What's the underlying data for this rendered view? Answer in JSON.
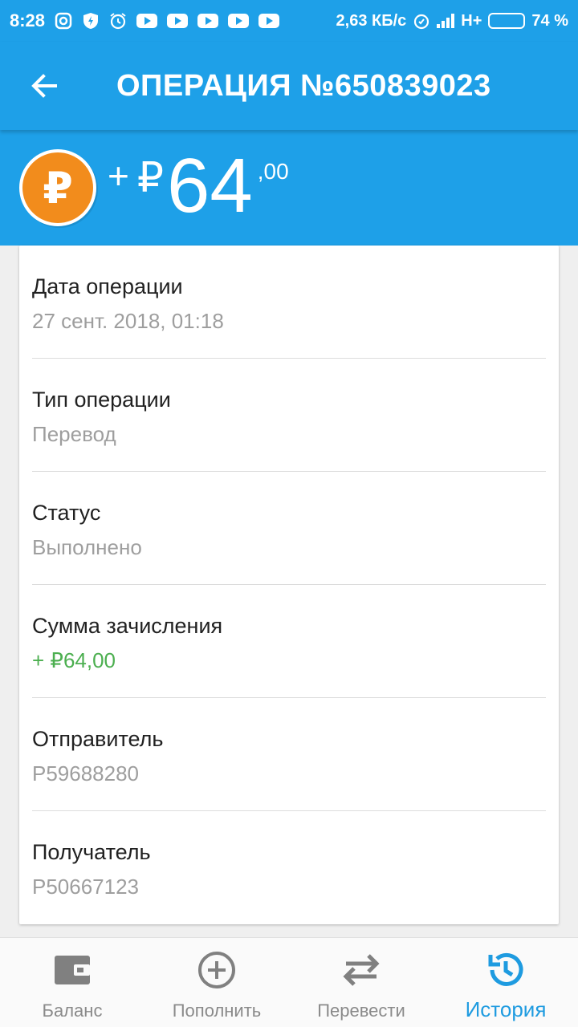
{
  "status_bar": {
    "time": "8:28",
    "net_speed": "2,63 КБ/с",
    "network": "H+",
    "battery": "74 %"
  },
  "toolbar": {
    "title": "ОПЕРАЦИЯ №650839023"
  },
  "amount": {
    "sign": "+",
    "currency": "₽",
    "integer": "64",
    "cents": ",00",
    "coin_symbol": "₽"
  },
  "details": [
    {
      "label": "Дата операции",
      "value": "27 сент. 2018, 01:18"
    },
    {
      "label": "Тип операции",
      "value": "Перевод"
    },
    {
      "label": "Статус",
      "value": "Выполнено"
    },
    {
      "label": "Сумма зачисления",
      "value": "+ ₽64,00"
    },
    {
      "label": "Отправитель",
      "value": "P59688280"
    },
    {
      "label": "Получатель",
      "value": "P50667123"
    }
  ],
  "nav": [
    {
      "label": "Баланс"
    },
    {
      "label": "Пополнить"
    },
    {
      "label": "Перевести"
    },
    {
      "label": "История"
    }
  ],
  "colors": {
    "primary": "#1ea0e8",
    "coin": "#f28c1c",
    "positive": "#4caf50",
    "active_nav": "#1e9be0"
  }
}
